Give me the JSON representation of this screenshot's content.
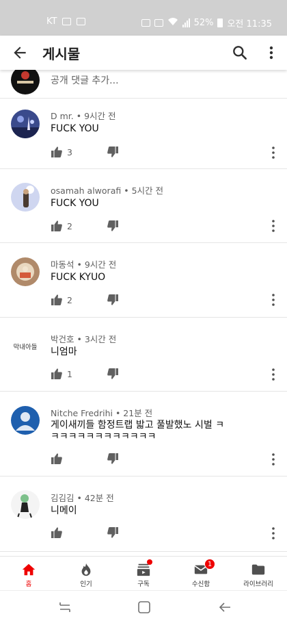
{
  "status_bar": {
    "carrier": "KT",
    "battery": "52%",
    "time": "오전 11:35"
  },
  "app_bar": {
    "title": "게시물"
  },
  "add_comment": {
    "placeholder": "공개 댓글 추가..."
  },
  "comments": [
    {
      "author": "D mr.",
      "time": "9시간 전",
      "text": "FUCK YOU",
      "likes": "3"
    },
    {
      "author": "osamah alworafi",
      "time": "5시간 전",
      "text": "FUCK YOU",
      "likes": "2"
    },
    {
      "author": "마동석",
      "time": "9시간 전",
      "text": "FUCK KYUO",
      "likes": "2"
    },
    {
      "author": "박건호",
      "time": "3시간 전",
      "text": "니엄마",
      "likes": "1",
      "avatar_text": "막내아들"
    },
    {
      "author": "Nitche Fredrihi",
      "time": "21분 전",
      "text": "게이새끼들 함정트랩 밟고 풀발했노 시벌 ㅋㅋㅋㅋㅋㅋㅋㅋㅋㅋㅋㅋㅋ",
      "likes": ""
    },
    {
      "author": "김김김",
      "time": "42분 전",
      "text": "니메이",
      "likes": ""
    }
  ],
  "bottom_nav": {
    "items": [
      {
        "label": "홈",
        "icon": "home-icon",
        "active": true
      },
      {
        "label": "인기",
        "icon": "fire-icon"
      },
      {
        "label": "구독",
        "icon": "subscriptions-icon"
      },
      {
        "label": "수신함",
        "icon": "mail-icon",
        "badge": "1"
      },
      {
        "label": "라이브러리",
        "icon": "folder-icon"
      }
    ]
  },
  "colors": {
    "accent": "#ee0000",
    "status_bar_bg": "#d0d0d0",
    "meta_text": "#606060"
  }
}
